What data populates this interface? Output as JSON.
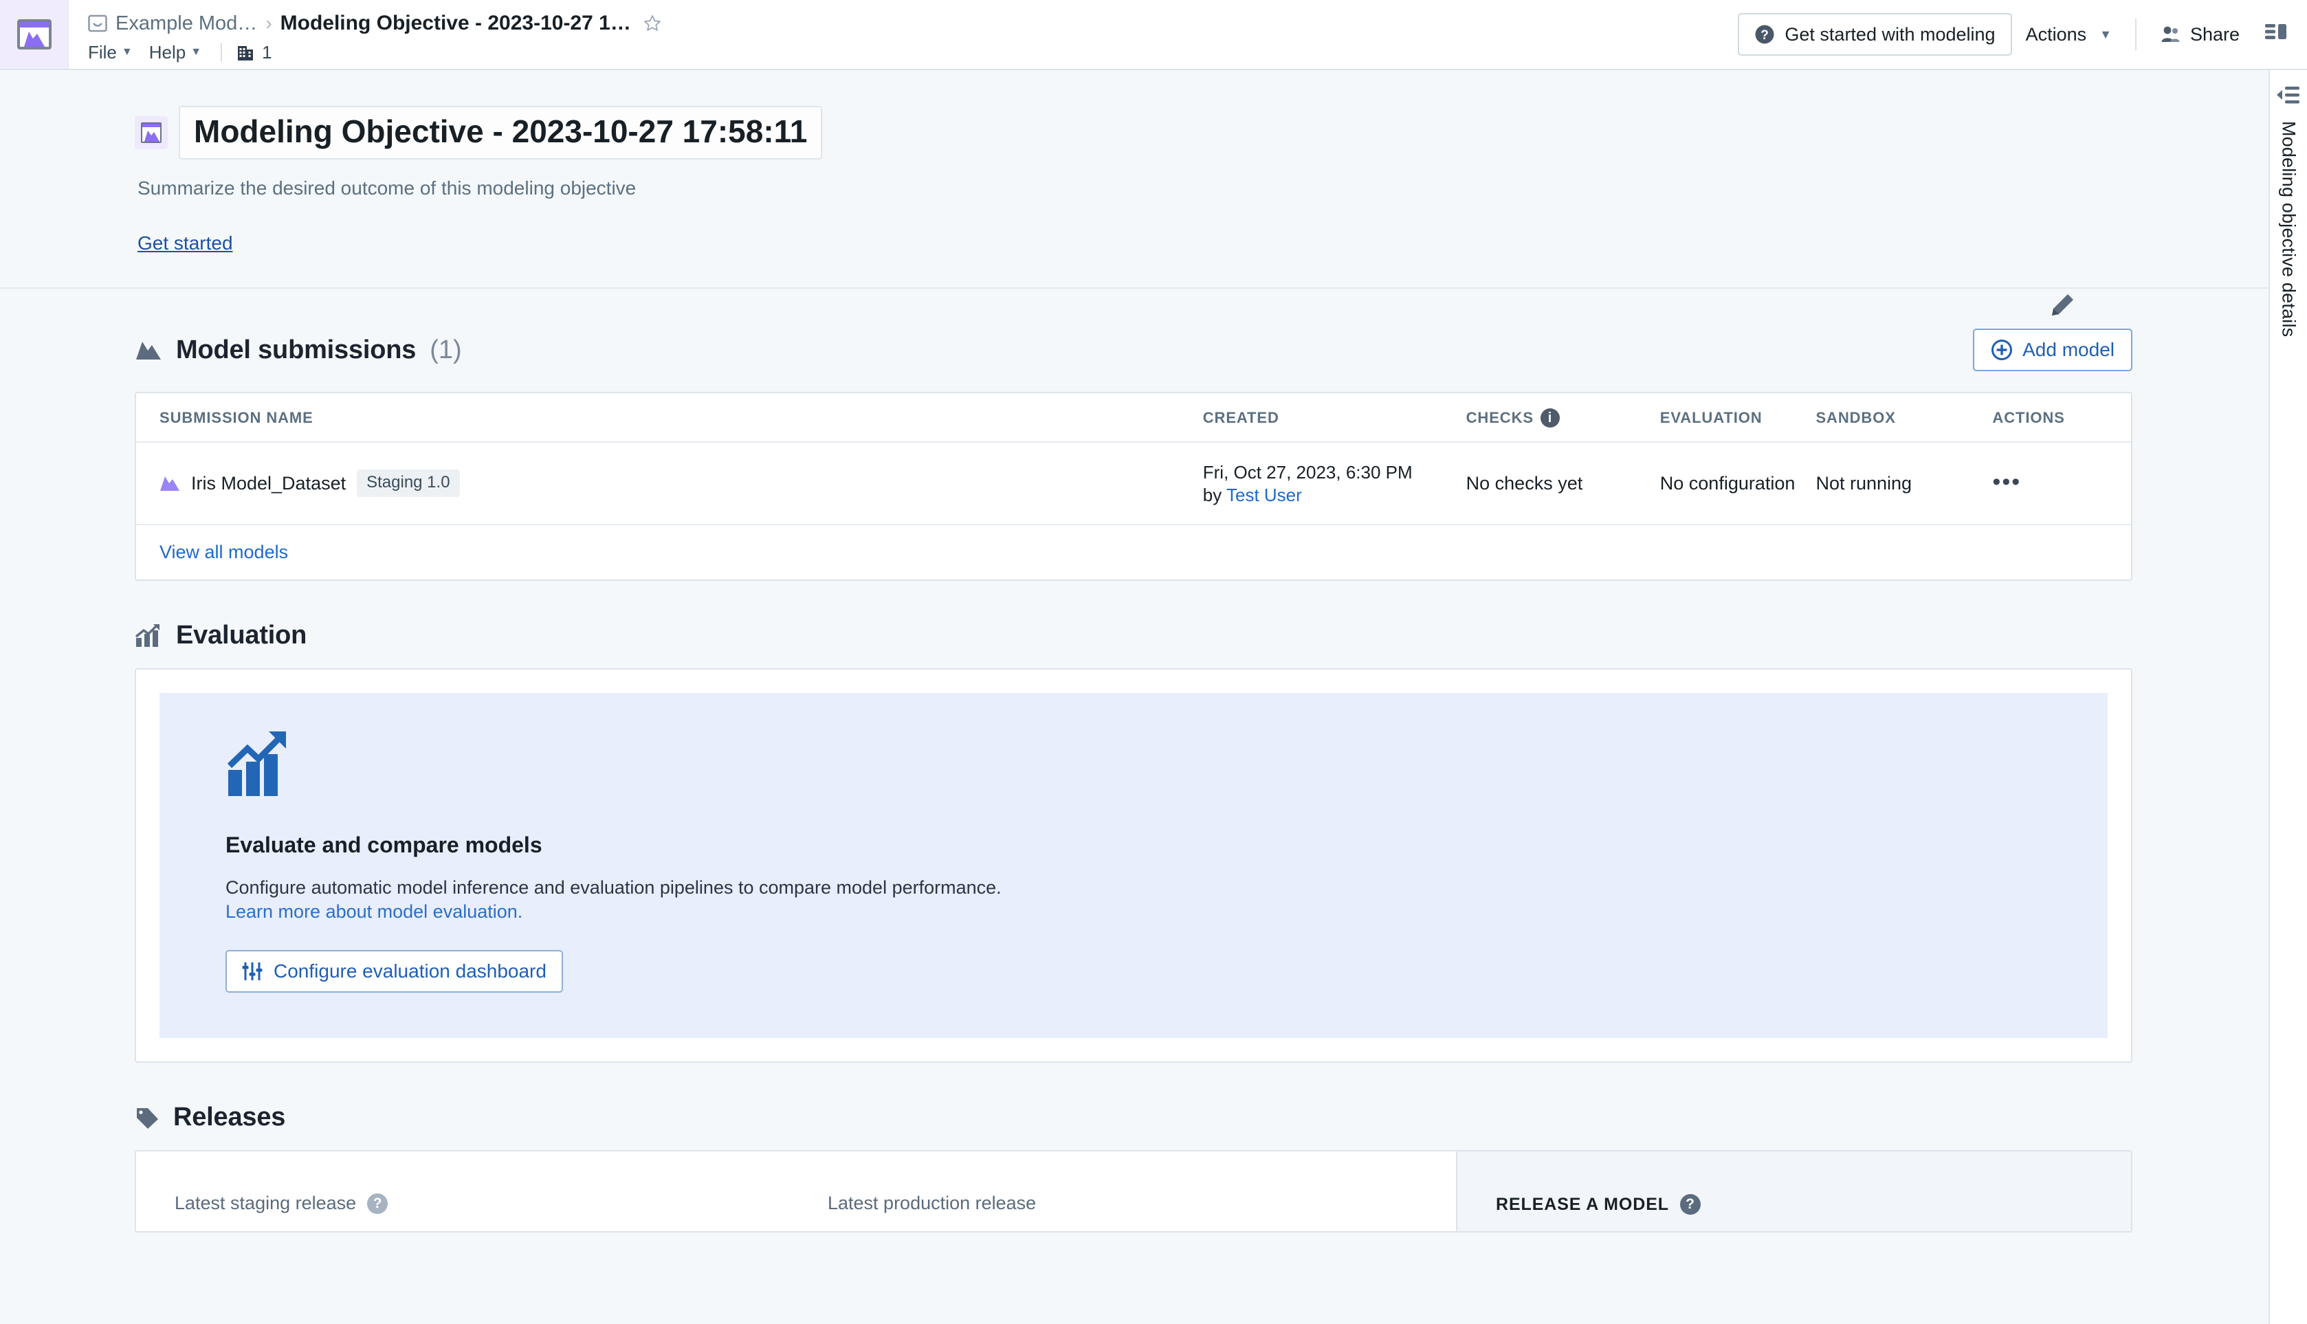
{
  "topbar": {
    "app_icon_name": "workspace-app-icon",
    "breadcrumb_parent": "Example Mod…",
    "breadcrumb_sep": "›",
    "breadcrumb_title": "Modeling Objective - 2023-10-27 1…",
    "menus": [
      {
        "label": "File"
      },
      {
        "label": "Help"
      }
    ],
    "org_count": "1",
    "get_started_button": "Get started with modeling",
    "actions_button": "Actions",
    "share_button": "Share"
  },
  "right_rail": {
    "label": "Modeling objective details"
  },
  "hero": {
    "title": "Modeling Objective - 2023-10-27 17:58:11",
    "subtitle": "Summarize the desired outcome of this modeling objective",
    "get_started_link": "Get started"
  },
  "submissions": {
    "heading": "Model submissions",
    "count": "(1)",
    "add_model_button": "Add model",
    "columns": [
      "SUBMISSION NAME",
      "CREATED",
      "CHECKS",
      "EVALUATION",
      "SANDBOX",
      "ACTIONS"
    ],
    "rows": [
      {
        "name": "Iris Model_Dataset",
        "tag": "Staging 1.0",
        "created_date": "Fri, Oct 27, 2023, 6:30 PM",
        "created_by_prefix": "by",
        "created_by": "Test User",
        "checks": "No checks yet",
        "evaluation": "No configuration",
        "sandbox": "Not running",
        "actions": "•••"
      }
    ],
    "view_all_link": "View all models"
  },
  "evaluation": {
    "heading": "Evaluation",
    "card_title": "Evaluate and compare models",
    "card_desc": "Configure automatic model inference and evaluation pipelines to compare model performance.",
    "card_link": "Learn more about model evaluation.",
    "configure_button": "Configure evaluation dashboard"
  },
  "releases": {
    "heading": "Releases",
    "staging_label": "Latest staging release",
    "production_label": "Latest production release",
    "release_a_model_label": "RELEASE A MODEL"
  },
  "colors": {
    "accent_blue": "#1f69c9",
    "brand_purple": "#8b6ef5",
    "page_bg": "#f5f8fa",
    "callout_bg": "#e8eefb"
  }
}
